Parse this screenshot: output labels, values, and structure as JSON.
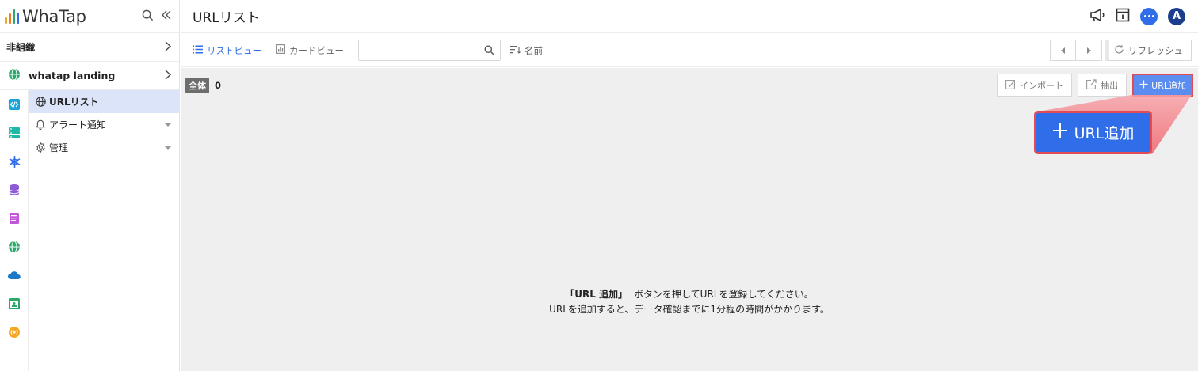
{
  "brand": {
    "name": "WhaTap"
  },
  "sidebar": {
    "org_label": "非組織",
    "project_name": "whatap landing",
    "menu": [
      {
        "label": "URLリスト",
        "icon": "globe-icon",
        "active": true
      },
      {
        "label": "アラート通知",
        "icon": "bell-icon",
        "active": false
      },
      {
        "label": "管理",
        "icon": "gear-icon",
        "active": false
      }
    ],
    "rail_icons": [
      "code-icon",
      "server-icon",
      "kubernetes-icon",
      "database-icon",
      "log-icon",
      "globe-icon",
      "cloud-icon",
      "browser-icon",
      "broadcast-icon"
    ]
  },
  "header": {
    "title": "URLリスト",
    "avatar_initial": "A"
  },
  "toolbar": {
    "list_view": "リストビュー",
    "card_view": "カードビュー",
    "search_placeholder": "",
    "sort_label": "名前",
    "refresh_label": "リフレッシュ"
  },
  "content": {
    "all_badge": "全体",
    "count": "0",
    "import_label": "インポート",
    "export_label": "抽出",
    "add_label": "URL追加",
    "callout_label": "URL追加",
    "empty_line1_bold": "「URL 追加」",
    "empty_line1": "ボタンを押してURLを登録してください。",
    "empty_line2": "URLを追加すると、データ確認までに1分程の時間がかかります。"
  },
  "colors": {
    "accent": "#2f6ee8",
    "highlight_border": "#e24b54",
    "active_menu_bg": "#dbe4f8"
  }
}
